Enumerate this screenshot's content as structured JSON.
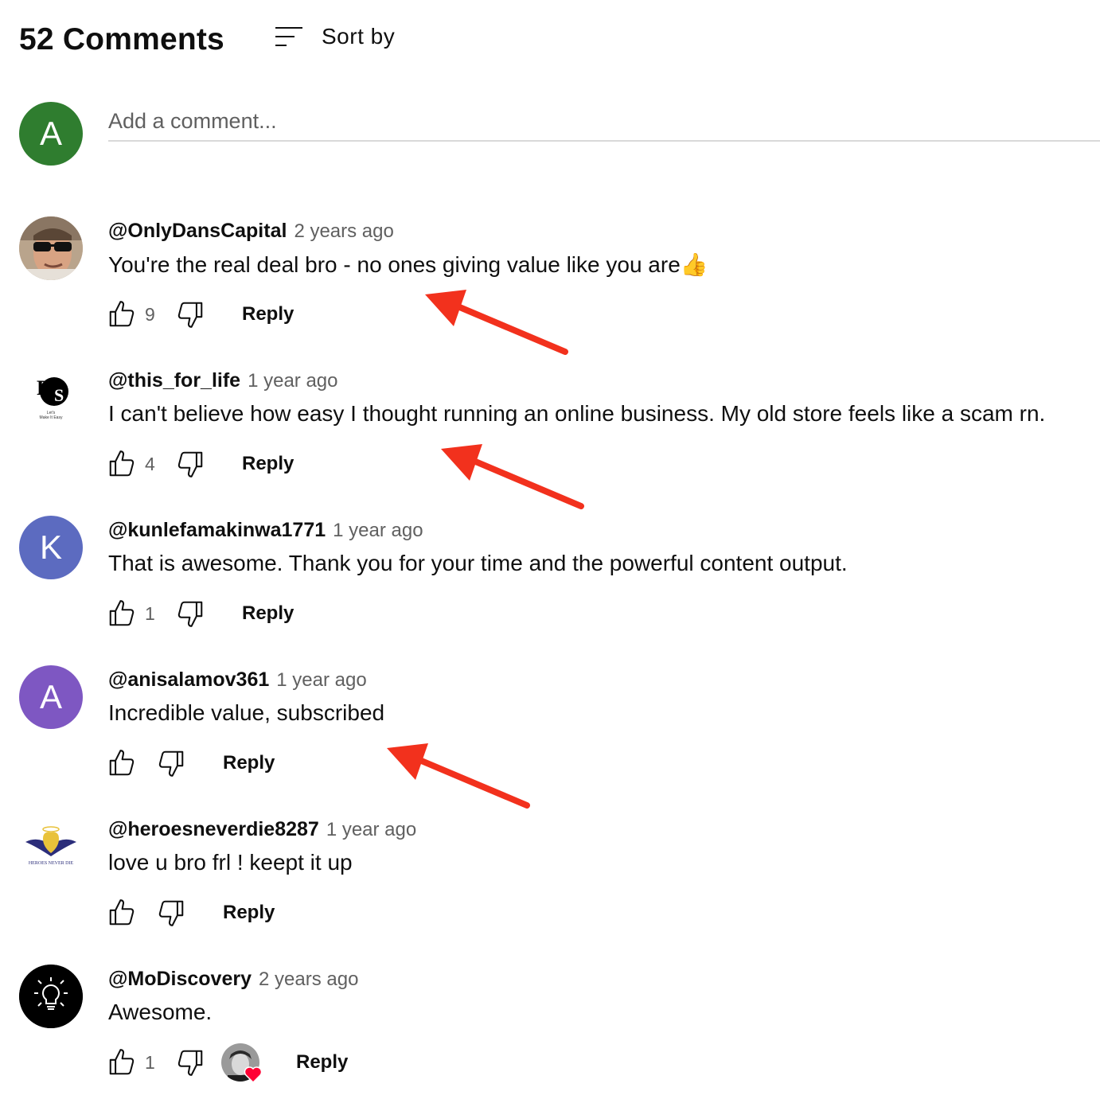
{
  "header": {
    "count": "52 Comments",
    "sort_label": "Sort by"
  },
  "add_comment": {
    "avatar_letter": "A",
    "placeholder": "Add a comment..."
  },
  "reply_label": "Reply",
  "colors": {
    "accent_arrow": "#f2311d",
    "avatar_green": "#2f7d2f",
    "avatar_blue": "#5c6bc0",
    "avatar_purple": "#7e57c2"
  },
  "comments": [
    {
      "author": "@OnlyDansCapital",
      "time": "2 years ago",
      "text": "You're the real deal bro - no ones giving value like you are",
      "emoji": "👍",
      "likes": "9",
      "avatar": "photo-sunglasses-man"
    },
    {
      "author": "@this_for_life",
      "time": "1 year ago",
      "text": "I can't believe how easy I thought running an online business. My old store feels like a scam rn.",
      "likes": "4",
      "avatar": "ps-logo",
      "avatar_letters": "PS",
      "avatar_caption": "Let's Make It Easy"
    },
    {
      "author": "@kunlefamakinwa1771",
      "time": "1 year ago",
      "text": "That is awesome. Thank you for your time and the powerful content output.",
      "likes": "1",
      "avatar": "letter",
      "avatar_letter": "K"
    },
    {
      "author": "@anisalamov361",
      "time": "1 year ago",
      "text": "Incredible value, subscribed",
      "likes": "",
      "avatar": "letter",
      "avatar_letter": "A"
    },
    {
      "author": "@heroesneverdie8287",
      "time": "1 year ago",
      "text": "love u bro frl ! keept it up",
      "likes": "",
      "avatar": "heroes-logo",
      "avatar_caption": "HEROES NEVER DIE"
    },
    {
      "author": "@MoDiscovery",
      "time": "2 years ago",
      "text": "Awesome.",
      "likes": "1",
      "avatar": "lightbulb-icon",
      "creator_hearted": true
    }
  ]
}
